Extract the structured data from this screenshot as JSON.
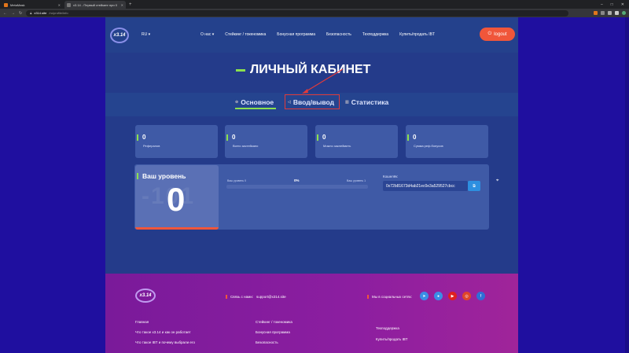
{
  "browser": {
    "tabs": [
      {
        "title": "MetaMask",
        "favicon_color": "#e2761b",
        "active": false
      },
      {
        "title": "x3.14 - Первый стейкинг при 0",
        "favicon_color": "#444",
        "active": true
      }
    ],
    "new_tab": "+",
    "url_host": "x314.site",
    "url_path": "/ru/profile/info",
    "window_buttons": [
      "–",
      "□",
      "✕"
    ]
  },
  "header": {
    "logo": "x3.14",
    "lang": "RU ▾",
    "menu": [
      "О нас ▾",
      "Стейкинг / токеномика",
      "Бонусная программа",
      "Безопасность",
      "Техподдержка",
      "Купить/продать IBT"
    ],
    "logout": "logout"
  },
  "page_title": "ЛИЧНЫЙ КАБИНЕТ",
  "tabs": [
    {
      "label": "Основное",
      "icon": "⊕"
    },
    {
      "label": "Ввод/вывод",
      "icon": "◁"
    },
    {
      "label": "Статистика",
      "icon": "▥"
    }
  ],
  "stats": [
    {
      "value": "0",
      "label": "Рефералов"
    },
    {
      "value": "0",
      "label": "Всего застейкано"
    },
    {
      "value": "0",
      "label": "Можно заклеймить"
    },
    {
      "value": "0",
      "label": "Сумма реф.бонусов"
    }
  ],
  "level": {
    "title": "Ваш уровень",
    "value": "0",
    "ghost": "-101",
    "progress_left": "Ваш уровень 0",
    "progress_center": "0%",
    "progress_right": "Ваш уровень 1",
    "progress_value": 0
  },
  "wallet": {
    "label": "Кошелёк:",
    "address": "0x72b81673d4ab21ec0e3a529527cbcc",
    "copy_icon": "⧉"
  },
  "footer": {
    "logo": "x3.14",
    "contact_label": "Связь с нами:",
    "contact_email": "support@x314.site",
    "social_label": "Мы в социальных сетях:",
    "social_icons": [
      {
        "name": "telegram-icon",
        "glyph": "➤",
        "color": "#3a8ee6"
      },
      {
        "name": "chat-icon",
        "glyph": "●",
        "color": "#3a8ee6"
      },
      {
        "name": "youtube-icon",
        "glyph": "▶",
        "color": "#e02020"
      },
      {
        "name": "instagram-icon",
        "glyph": "◎",
        "color": "#e0452a"
      },
      {
        "name": "facebook-icon",
        "glyph": "f",
        "color": "#2f6fd6"
      }
    ],
    "col1": [
      "Главная",
      "Что такое x3.14 и как он работает",
      "Что такое IBT и почему выбрали его"
    ],
    "col2": [
      "Стейкинг / токеномика",
      "Бонусная программа",
      "Безопасность"
    ],
    "col3": [
      "Техподдержка",
      "Купить/продать IBT"
    ]
  },
  "colors": {
    "accent_green": "#8be04e",
    "accent_orange": "#f0563a",
    "annotation_red": "#e23a3a"
  }
}
